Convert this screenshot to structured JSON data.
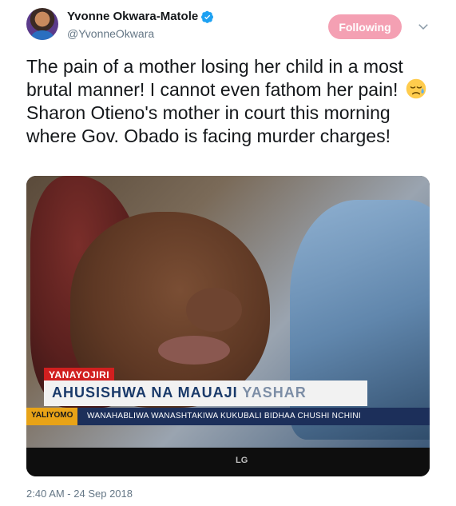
{
  "author": {
    "display_name": "Yvonne Okwara-Matole",
    "handle": "@YvonneOkwara",
    "verified": true
  },
  "follow_button_label": "Following",
  "tweet": {
    "text_part1": "The pain of a mother losing her child in a most brutal manner! I cannot even fathom her pain!",
    "emoji": "disappointed-relieved-face",
    "text_part2": "Sharon Otieno's mother in court this morning where Gov. Obado is facing murder charges!",
    "timestamp": "2:40 AM - 24 Sep 2018"
  },
  "media": {
    "live_badge": "YANAYOJIRI",
    "headline_main": "AHUSISHWA NA MAUAJI ",
    "headline_fade": "YASHAR",
    "ticker_label": "YALIYOMO",
    "ticker_text": "WANAHABLIWA WANASHTAKIWA KUKUBALI BIDHAA CHUSHI NCHINI",
    "tv_brand": "LG"
  },
  "colors": {
    "follow_button": "#f4a0b3",
    "verified_badge": "#1da1f2",
    "secondary_text": "#657786"
  }
}
